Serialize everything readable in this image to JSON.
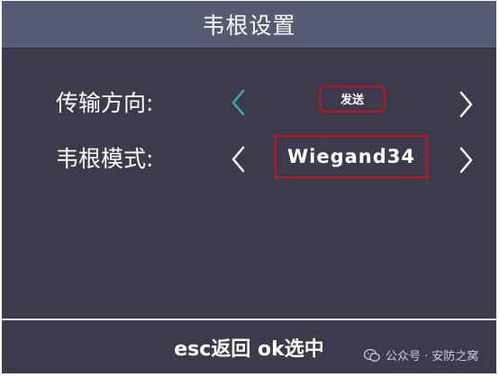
{
  "header": {
    "title": "韦根设置"
  },
  "rows": [
    {
      "label": "传输方向:",
      "value": "发送",
      "left_chevron": "chevron-left-icon",
      "right_chevron": "chevron-right-icon",
      "left_chevron_color": "#2bb5ad"
    },
    {
      "label": "韦根模式:",
      "value": "Wiegand34",
      "left_chevron": "chevron-left-icon",
      "right_chevron": "chevron-right-icon",
      "left_chevron_color": "#ffffff"
    }
  ],
  "footer": {
    "hint": "esc返回 ok选中"
  },
  "watermark": {
    "text": "公众号 · 安防之窝",
    "icon": "wechat-icon"
  },
  "colors": {
    "background": "#3c3a4c",
    "header": "#565a73",
    "highlight_border": "#c4151c",
    "selected_chevron": "#2bb5ad"
  }
}
